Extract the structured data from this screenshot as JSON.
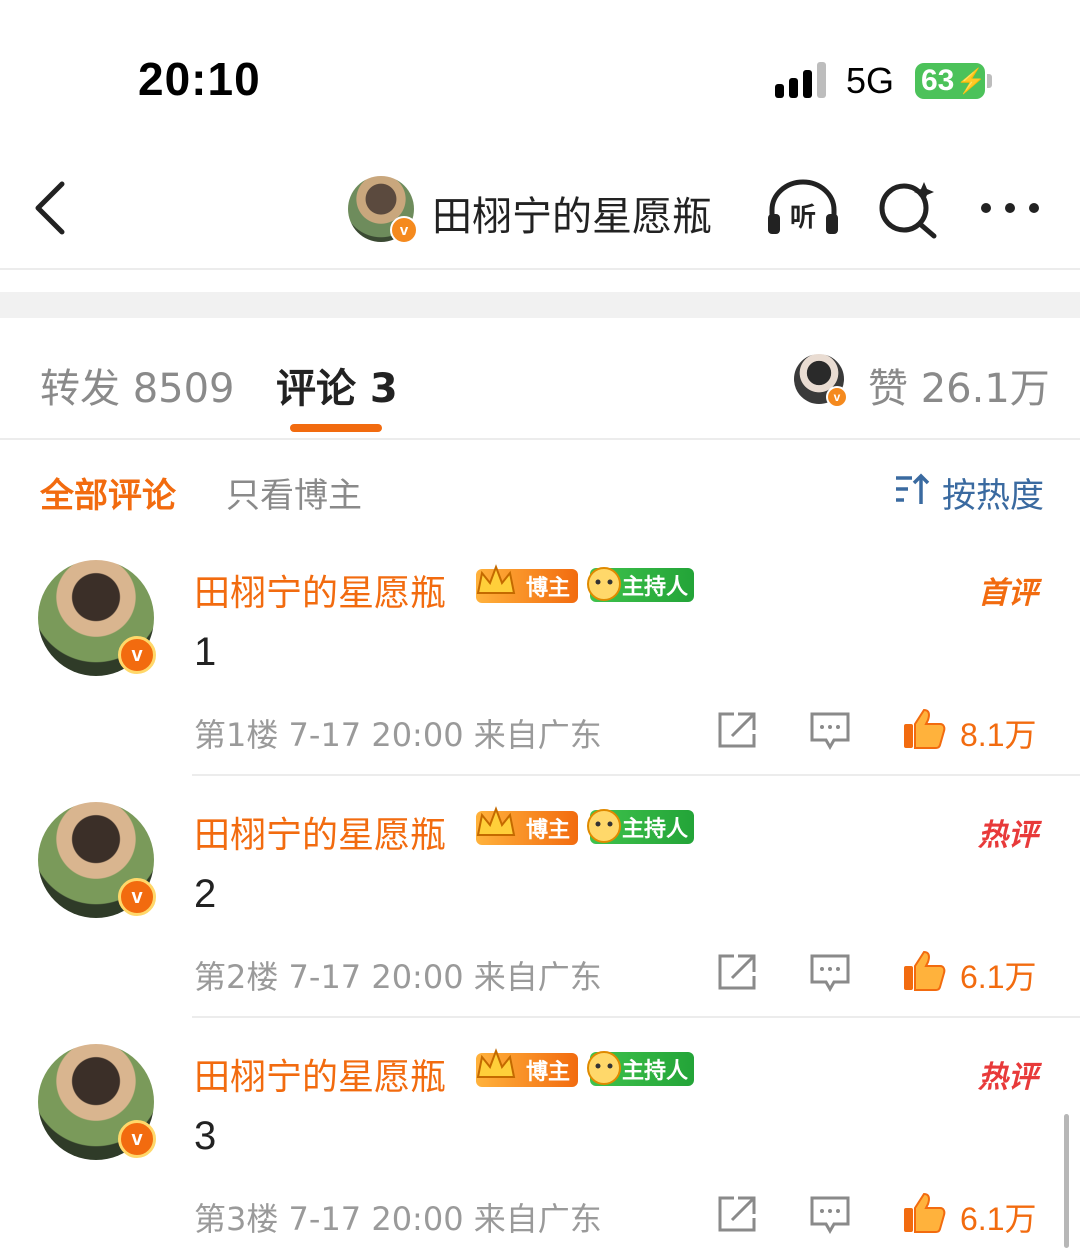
{
  "status_bar": {
    "time": "20:10",
    "network": "5G",
    "battery": "63"
  },
  "nav": {
    "title": "田栩宁的星愿瓶"
  },
  "tabs": {
    "repost": "转发 8509",
    "comments": "评论 3",
    "likes": "赞 26.1万"
  },
  "filters": {
    "all": "全部评论",
    "blogger_only": "只看博主",
    "sort": "按热度"
  },
  "badges": {
    "blogger": "博主",
    "host": "主持人"
  },
  "comments": [
    {
      "name": "田栩宁的星愿瓶",
      "tag": "首评",
      "text": "1",
      "meta": "第1楼 7-17 20:00 来自广东",
      "likes": "8.1万"
    },
    {
      "name": "田栩宁的星愿瓶",
      "tag": "热评",
      "text": "2",
      "meta": "第2楼 7-17 20:00 来自广东",
      "likes": "6.1万"
    },
    {
      "name": "田栩宁的星愿瓶",
      "tag": "热评",
      "text": "3",
      "meta": "第3楼 7-17 20:00 来自广东",
      "likes": "6.1万"
    }
  ],
  "colors": {
    "accent": "#f26b0f",
    "hot_tag": "#e83a3a",
    "sort_link": "#3a6aa0",
    "host_badge": "#3fc24c"
  }
}
